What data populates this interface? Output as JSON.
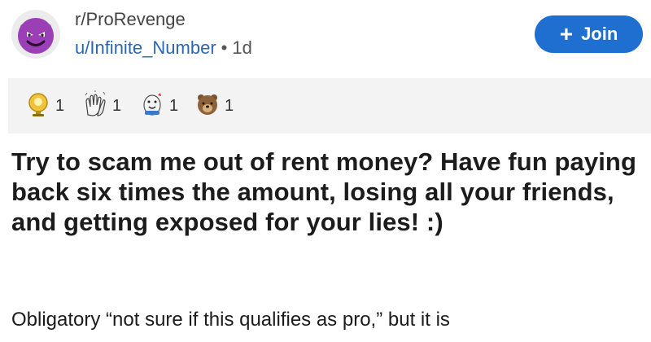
{
  "post": {
    "subreddit": "r/ProRevenge",
    "author": "u/Infinite_Number",
    "separator": "•",
    "age": "1d",
    "join_label": "Join",
    "join_icon": "plus-icon",
    "awards": [
      {
        "icon": "trophy-award-icon",
        "count": "1"
      },
      {
        "icon": "clapping-hands-award-icon",
        "count": "1"
      },
      {
        "icon": "wholesome-seal-award-icon",
        "count": "1"
      },
      {
        "icon": "bear-award-icon",
        "count": "1"
      }
    ],
    "title": "Try to scam me out of rent money? Have fun paying back six times the amount, losing all your friends, and getting exposed for your lies! :)",
    "body_preview": "Obligatory “not sure if this qualifies as pro,” but it is"
  },
  "colors": {
    "join_button": "#1f6fd1",
    "username": "#2a67b3",
    "awards_bar": "#f3f3f3",
    "avatar_face": "#9b3fb6"
  }
}
